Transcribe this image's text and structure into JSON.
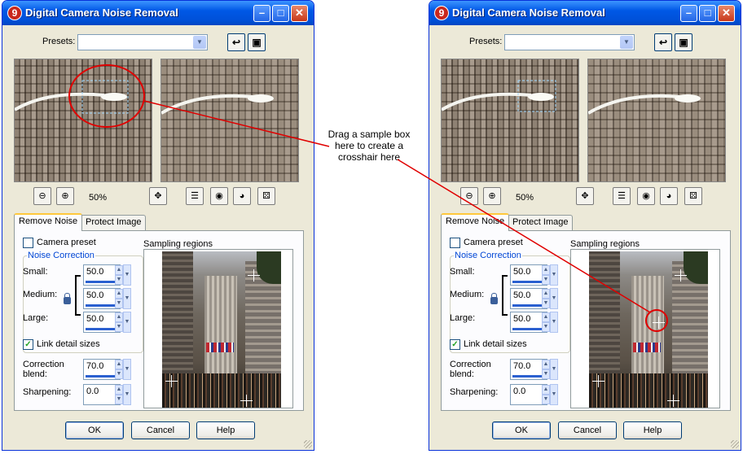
{
  "dialog": {
    "title": "Digital Camera Noise Removal",
    "app_icon_text": "9",
    "presets_label": "Presets:",
    "zoom_level": "50%",
    "tabs": [
      "Remove Noise",
      "Protect Image"
    ],
    "camera_preset_label": "Camera preset",
    "noise_correction_title": "Noise Correction",
    "small_label": "Small:",
    "medium_label": "Medium:",
    "large_label": "Large:",
    "small_value": "50.0",
    "medium_value": "50.0",
    "large_value": "50.0",
    "link_detail_label": "Link detail sizes",
    "correction_blend_label": "Correction blend:",
    "correction_blend_value": "70.0",
    "sharpening_label": "Sharpening:",
    "sharpening_value": "0.0",
    "sampling_regions_label": "Sampling regions",
    "ok_label": "OK",
    "cancel_label": "Cancel",
    "help_label": "Help"
  },
  "callout_text": "Drag a sample box here to create a crosshair here",
  "colors": {
    "title_bar": "#0058e6",
    "annotation_red": "#e00000",
    "dialog_bg": "#ece9d8"
  },
  "icons": [
    "zoom-out-icon",
    "zoom-in-icon",
    "pan-icon",
    "preview-toggle-icon",
    "lock-eye-icon",
    "eye-icon",
    "randomize-icon",
    "save-preset-icon",
    "reset-preset-icon",
    "lock-icon"
  ]
}
